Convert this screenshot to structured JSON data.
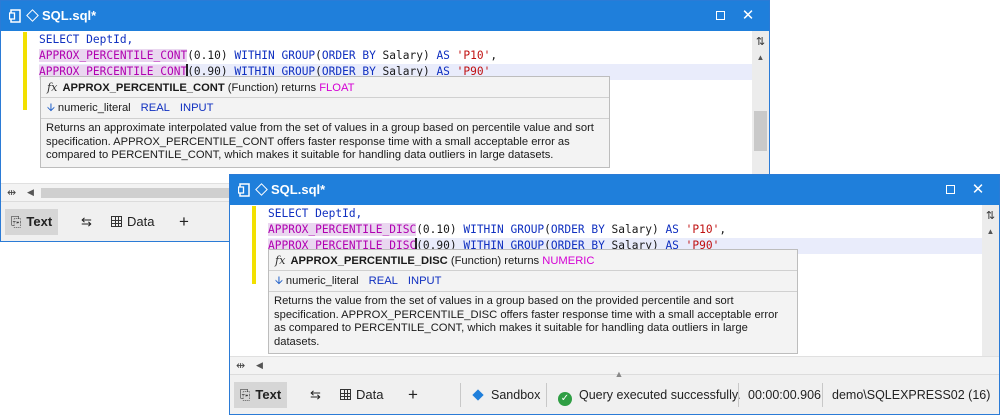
{
  "window1": {
    "title": "SQL.sql*",
    "code": {
      "line1": "SELECT DeptId,",
      "line2": {
        "fn": "APPROX_PERCENTILE_CONT",
        "pre": "(0.10) ",
        "within": "WITHIN GROUP",
        "open": "(",
        "orderby": "ORDER BY",
        "col": " Salary) ",
        "as": "AS",
        "sp": " ",
        "alias": "'P10'",
        "tail": ","
      },
      "line3": {
        "fn": "APPROX_PERCENTILE_CONT",
        "pre": "(0.90) ",
        "within": "WITHIN GROUP",
        "open": "(",
        "orderby": "ORDER BY",
        "col": " Salary) ",
        "as": "AS",
        "sp": " ",
        "alias": "'P90'",
        "tail": ""
      }
    },
    "tooltip": {
      "fx": "fx",
      "function_name": "APPROX_PERCENTILE_CONT",
      "kind": " (Function) returns ",
      "returns": "FLOAT",
      "param_name": "numeric_literal",
      "param_type": "REAL",
      "param_dir": "INPUT",
      "description": "Returns an approximate interpolated value from the set of values in a group based on percentile value and sort specification. APPROX_PERCENTILE_CONT offers faster response time with a small acceptable error as compared to PERCENTILE_CONT, which makes it suitable for handling data outliers in large datasets."
    },
    "tabs": {
      "text": "Text",
      "data": "Data",
      "add": "+"
    }
  },
  "window2": {
    "title": "SQL.sql*",
    "code": {
      "line1": "SELECT DeptId,",
      "line2": {
        "fn": "APPROX_PERCENTILE_DISC",
        "pre": "(0.10) ",
        "within": "WITHIN GROUP",
        "open": "(",
        "orderby": "ORDER BY",
        "col": " Salary) ",
        "as": "AS",
        "sp": " ",
        "alias": "'P10'",
        "tail": ","
      },
      "line3": {
        "fn": "APPROX_PERCENTILE_DISC",
        "pre": "(0.90) ",
        "within": "WITHIN GROUP",
        "open": "(",
        "orderby": "ORDER BY",
        "col": " Salary) ",
        "as": "AS",
        "sp": " ",
        "alias": "'P90'",
        "tail": ""
      }
    },
    "tooltip": {
      "fx": "fx",
      "function_name": "APPROX_PERCENTILE_DISC",
      "kind": " (Function) returns ",
      "returns": "NUMERIC",
      "param_name": "numeric_literal",
      "param_type": "REAL",
      "param_dir": "INPUT",
      "description": "Returns the value from the set of values in a group based on the provided percentile and sort specification. APPROX_PERCENTILE_DISC offers faster response time with a small acceptable error as compared to PERCENTILE_CONT, which makes it suitable for handling data outliers in large datasets."
    },
    "tabs": {
      "text": "Text",
      "data": "Data",
      "add": "+"
    },
    "status": {
      "environment": "Sandbox",
      "message": "Query executed successfully.",
      "elapsed": "00:00:00.906",
      "connection": "demo\\SQLEXPRESS02 (16)"
    }
  },
  "icons": {
    "doc": "document-icon",
    "diamond": "diamond-icon",
    "maximize": "maximize-icon",
    "close": "close-icon",
    "text_tab": "text-tab-icon",
    "swap": "swap-icon",
    "grid": "grid-icon",
    "success": "check-circle-icon"
  },
  "colors": {
    "titlebar": "#1f7fdb",
    "keyword": "#1030c0",
    "function": "#b000b0",
    "string": "#c01010",
    "returns_type": "#d400d4",
    "success": "#2f9e44"
  }
}
